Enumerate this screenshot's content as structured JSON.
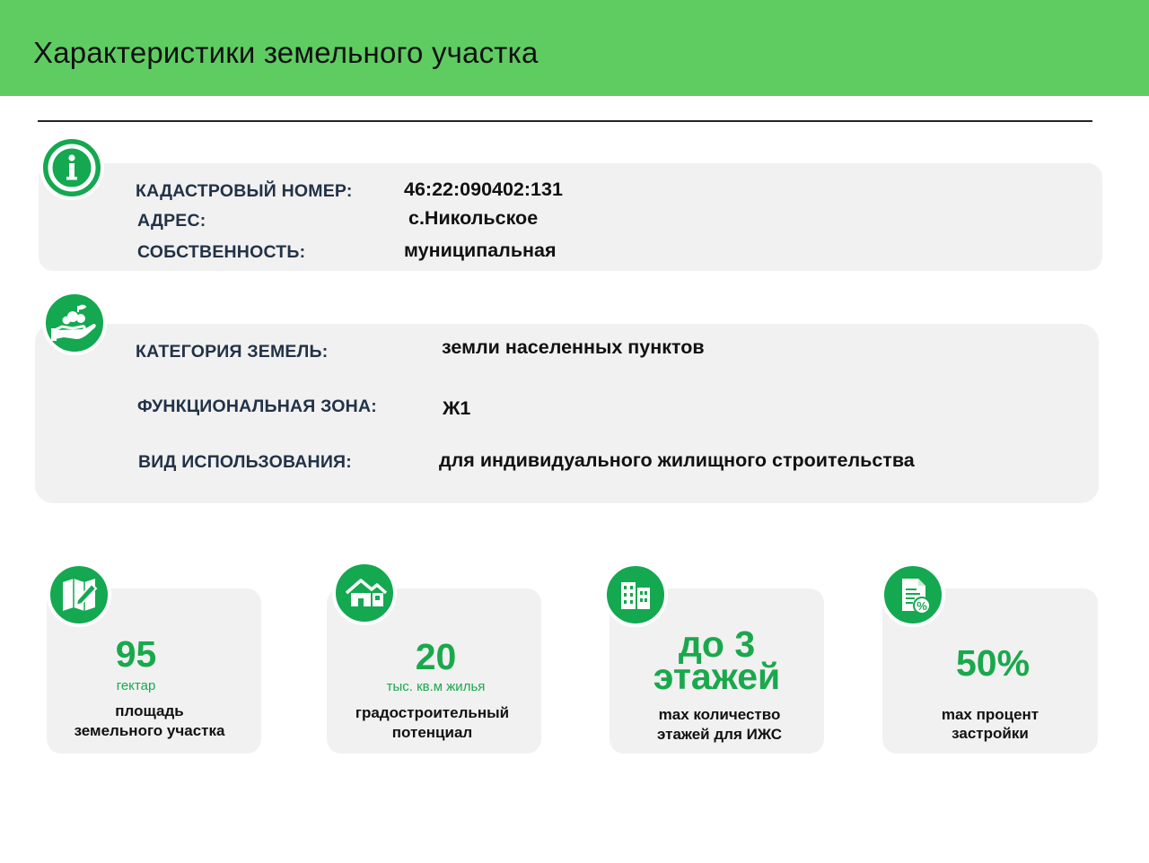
{
  "header": {
    "title": "Характеристики земельного участка"
  },
  "info": {
    "icon": "info-icon",
    "rows": [
      {
        "label": "КАДАСТРОВЫЙ НОМЕР:",
        "value": "46:22:090402:131"
      },
      {
        "label": "АДРЕС:",
        "value": "с.Никольское"
      },
      {
        "label": "СОБСТВЕННОСТЬ:",
        "value": "муниципальная"
      }
    ]
  },
  "land": {
    "icon": "hand-land-icon",
    "rows": [
      {
        "label": "КАТЕГОРИЯ ЗЕМЕЛЬ:",
        "value": "земли населенных пунктов"
      },
      {
        "label": "ФУНКЦИОНАЛЬНАЯ ЗОНА:",
        "value": "Ж1"
      },
      {
        "label": "ВИД ИСПОЛЬЗОВАНИЯ:",
        "value": "для индивидуального жилищного строительства"
      }
    ]
  },
  "stats": [
    {
      "icon": "map-pencil-icon",
      "value": "95",
      "unit": "гектар",
      "desc1": "площадь",
      "desc2": "земельного участка"
    },
    {
      "icon": "houses-icon",
      "value": "20",
      "unit": "тыс. кв.м жилья",
      "desc1": "градостроительный",
      "desc2": "потенциал"
    },
    {
      "icon": "buildings-icon",
      "value1": "до 3",
      "value2": "этажей",
      "desc1": "max количество",
      "desc2": "этажей для ИЖС"
    },
    {
      "icon": "document-percent-icon",
      "value": "50%",
      "desc1": "max процент",
      "desc2": "застройки"
    }
  ],
  "colors": {
    "header_green": "#5fcc62",
    "accent_green": "#14a850",
    "card_bg": "#f1f1f1",
    "label_navy": "#223247"
  }
}
